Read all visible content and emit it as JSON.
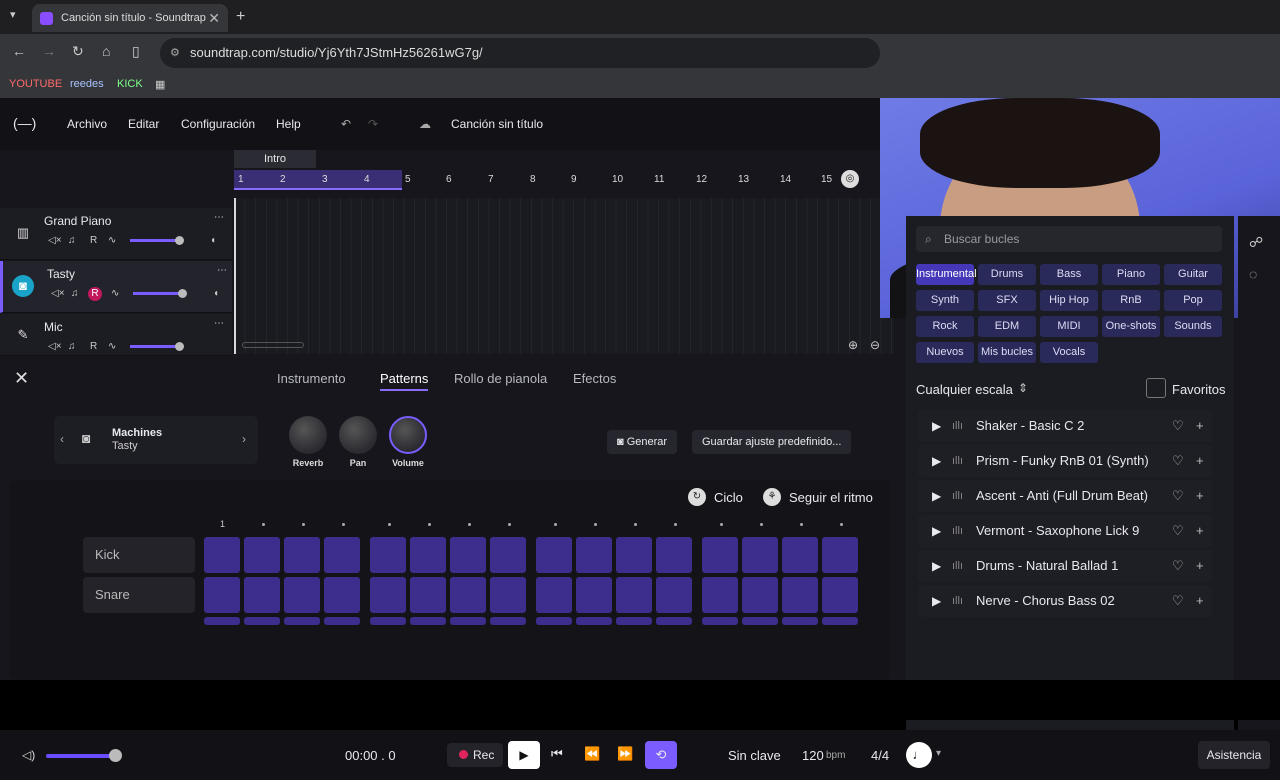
{
  "browser": {
    "tab_title": "Canción sin título - Soundtrap",
    "url": "soundtrap.com/studio/Yj6Yth7JStmHz56261wG7g/",
    "bookmarks": [
      "YOUTUBE",
      "reedes",
      "KICK"
    ]
  },
  "menu": {
    "logo": "(—)",
    "items": [
      "Archivo",
      "Editar",
      "Configuración",
      "Help"
    ],
    "song_title": "Canción sin título"
  },
  "timeline": {
    "section": "Intro",
    "bars": [
      "1",
      "2",
      "3",
      "4",
      "5",
      "6",
      "7",
      "8",
      "9",
      "10",
      "11",
      "12",
      "13",
      "14",
      "15"
    ]
  },
  "tracks": [
    {
      "name": "Grand Piano",
      "icon": "piano-icon",
      "rec": "R"
    },
    {
      "name": "Tasty",
      "icon": "drum-icon",
      "rec": "R",
      "selected": true
    },
    {
      "name": "Mic",
      "icon": "mic-icon",
      "rec": "R"
    }
  ],
  "editor": {
    "tabs": [
      "Instrumento",
      "Patterns",
      "Rollo de pianola",
      "Efectos"
    ],
    "active_tab": "Patterns",
    "machine_title": "Machines",
    "machine_subtitle": "Tasty",
    "knobs": [
      "Reverb",
      "Pan",
      "Volume"
    ],
    "generate_label": "Generar",
    "save_preset_label": "Guardar ajuste predefinido...",
    "cycle_label": "Ciclo",
    "follow_label": "Seguir el ritmo",
    "step_start": "1",
    "rows": [
      "Kick",
      "Snare"
    ]
  },
  "library": {
    "search_placeholder": "Buscar bucles",
    "chips": [
      "Instrumental",
      "Drums",
      "Bass",
      "Piano",
      "Guitar",
      "Synth",
      "SFX",
      "Hip Hop",
      "RnB",
      "Pop",
      "Rock",
      "EDM",
      "MIDI",
      "One-shots",
      "Sounds",
      "Nuevos",
      "Mis bucles",
      "Vocals"
    ],
    "scale_label": "Cualquier escala",
    "favorites_label": "Favoritos",
    "loops": [
      "Shaker - Basic C 2",
      "Prism - Funky RnB 01 (Synth)",
      "Ascent - Anti (Full Drum Beat)",
      "Vermont - Saxophone Lick 9",
      "Drums - Natural Ballad 1",
      "Nerve - Chorus Bass 02"
    ]
  },
  "transport": {
    "time": "00:00 . 0",
    "rec_label": "Rec",
    "key": "Sin clave",
    "tempo": "120",
    "tempo_unit": "bpm",
    "meter": "4/4",
    "assist_label": "Asistencia"
  },
  "colors": {
    "accent": "#7a5cff",
    "pad": "#3d2d8c",
    "rec": "#e0245e"
  }
}
